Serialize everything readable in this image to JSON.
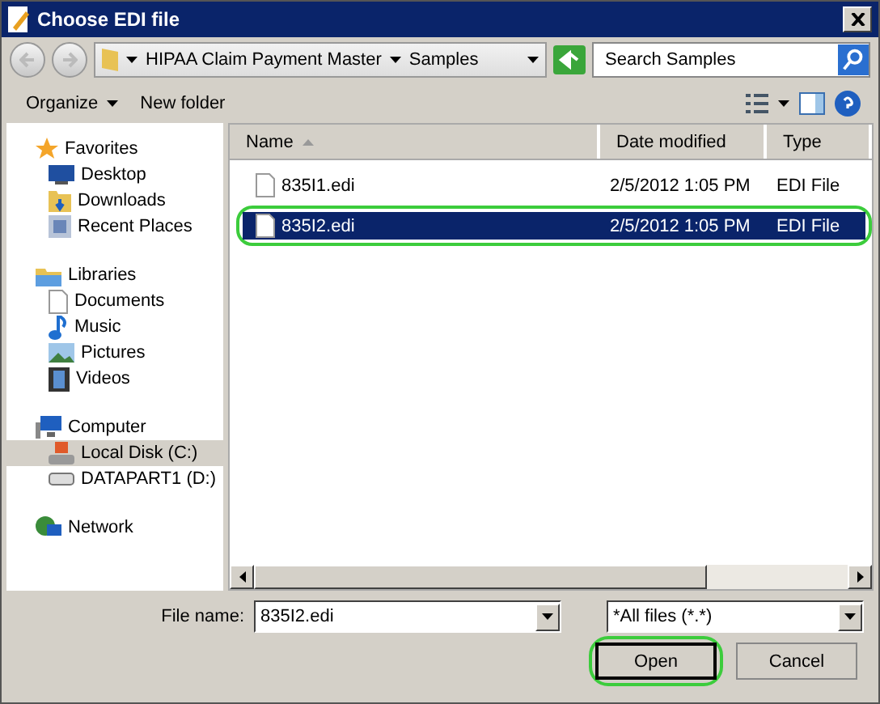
{
  "window": {
    "title": "Choose EDI file"
  },
  "breadcrumb": [
    "HIPAA Claim Payment Master",
    "Samples"
  ],
  "search": {
    "placeholder": "Search Samples"
  },
  "toolbar": {
    "organize": "Organize",
    "new_folder": "New folder"
  },
  "sidebar": {
    "groups": [
      {
        "label": "Favorites",
        "selected": false,
        "children": [
          {
            "label": "Desktop",
            "selected": false
          },
          {
            "label": "Downloads",
            "selected": false
          },
          {
            "label": "Recent Places",
            "selected": false
          }
        ]
      },
      {
        "label": "Libraries",
        "selected": false,
        "children": [
          {
            "label": "Documents",
            "selected": false
          },
          {
            "label": "Music",
            "selected": false
          },
          {
            "label": "Pictures",
            "selected": false
          },
          {
            "label": "Videos",
            "selected": false
          }
        ]
      },
      {
        "label": "Computer",
        "selected": false,
        "children": [
          {
            "label": "Local Disk (C:)",
            "selected": true
          },
          {
            "label": "DATAPART1 (D:)",
            "selected": false
          }
        ]
      },
      {
        "label": "Network",
        "selected": false
      }
    ]
  },
  "table": {
    "columns": [
      "Name",
      "Date modified",
      "Type"
    ],
    "rows": [
      {
        "name": "835I1.edi",
        "date": "2/5/2012 1:05 PM",
        "type": "EDI File",
        "selected": false,
        "highlighted": false
      },
      {
        "name": "835I2.edi",
        "date": "2/5/2012 1:05 PM",
        "type": "EDI File",
        "selected": true,
        "highlighted": true
      }
    ]
  },
  "file_name": {
    "label": "File name:",
    "value": "835I2.edi"
  },
  "file_type": {
    "value": "*All files (*.*)"
  },
  "buttons": [
    {
      "label": "Open",
      "default": true,
      "highlighted": true
    },
    {
      "label": "Cancel",
      "default": false,
      "highlighted": false
    }
  ]
}
